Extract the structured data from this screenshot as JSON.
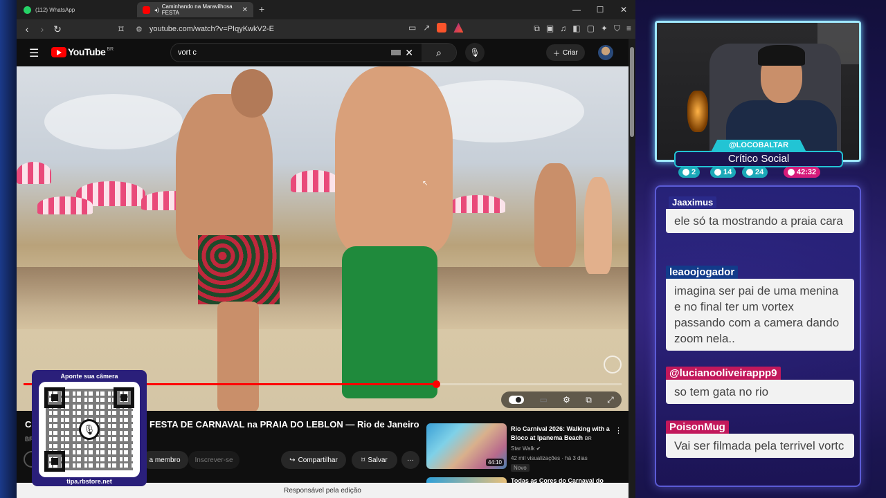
{
  "browser": {
    "tabs": [
      {
        "label": "(112) WhatsApp",
        "icon": "whatsapp-icon",
        "color": "#25d366"
      },
      {
        "label": "Caminhando na Maravilhosa FESTA",
        "icon": "youtube-icon",
        "color": "#ff0000"
      }
    ],
    "new_tab": "+",
    "url": "youtube.com/watch?v=PIqyKwkV2-E",
    "controls": {
      "minimize": "—",
      "maximize": "☐",
      "close": "✕"
    }
  },
  "youtube": {
    "logo": "YouTube",
    "country": "BR",
    "search": {
      "query": "vort c"
    },
    "create_label": "Criar",
    "video": {
      "progress_percent": 69
    },
    "title": "FESTA DE CARNAVAL na PRAIA DO LEBLON — Rio de Janeiro",
    "title_prefix": "C",
    "sub_prefix": "BR",
    "buttons": {
      "member": "a membro",
      "subscribe": "Inscrever-se",
      "share": "Compartilhar",
      "save": "Salvar",
      "more": "···"
    },
    "recommendations": [
      {
        "title": "Rio Carnival 2026: Walking with a Bloco at Ipanema Beach",
        "badge_cc": "BR",
        "channel": "Star Walk",
        "meta": "42 mil visualizações · há 3 dias",
        "tag": "Novo",
        "duration": "44:10"
      },
      {
        "title": "Todas as Cores do Carnaval do"
      }
    ],
    "status_bar": "Responsável pela edição"
  },
  "qr": {
    "top": "Aponte sua câmera",
    "bottom": "tipa.rbstore.net"
  },
  "stream": {
    "handle": "@LOCOBALTAR",
    "role": "Crítico Social",
    "stats": [
      {
        "icon": "twitch-icon",
        "value": "2"
      },
      {
        "icon": "youtube-icon",
        "value": "14"
      },
      {
        "icon": "kick-icon",
        "value": "24"
      },
      {
        "icon": "clock-icon",
        "value": "42:32"
      }
    ]
  },
  "chat": [
    {
      "author": "Jaaximus",
      "text": "ele só ta mostrando a praia cara",
      "color": "#2a2a8a"
    },
    {
      "author": "leaoojogador",
      "text": "imagina ser pai de uma menina e no final ter um vortex passando com a camera dando zoom nela..",
      "color": "#123b8a"
    },
    {
      "author": "@lucianooliveirappp9",
      "text": "so tem gata no rio",
      "color": "#c2185b"
    },
    {
      "author": "PoisonMug",
      "text": "Vai ser filmada pela terrivel vortc",
      "color": "#c2185b"
    }
  ]
}
